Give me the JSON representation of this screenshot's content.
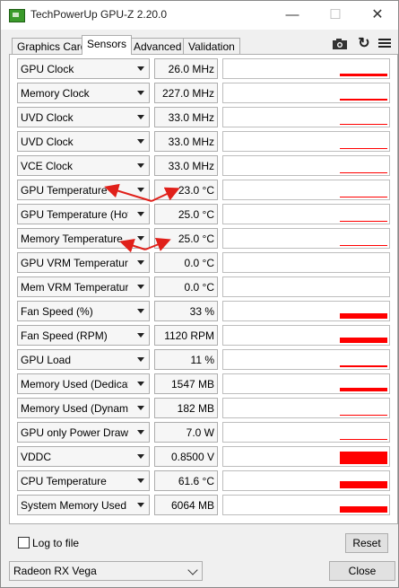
{
  "window": {
    "title": "TechPowerUp GPU-Z 2.20.0",
    "minimize_icon": "minimize-icon",
    "maximize_icon": "maximize-icon",
    "close_icon": "close-icon"
  },
  "tabs": [
    {
      "label": "Graphics Card",
      "active": false
    },
    {
      "label": "Sensors",
      "active": true
    },
    {
      "label": "Advanced",
      "active": false
    },
    {
      "label": "Validation",
      "active": false
    }
  ],
  "toolbar": {
    "icons": [
      "camera-icon",
      "refresh-icon",
      "hamburger-menu-icon"
    ]
  },
  "graph_color": "#ff0000",
  "sensors": [
    {
      "name": "GPU Clock",
      "value": "26.0 MHz",
      "graph_level": 0.15
    },
    {
      "name": "Memory Clock",
      "value": "227.0 MHz",
      "graph_level": 0.08
    },
    {
      "name": "UVD Clock",
      "value": "33.0 MHz",
      "graph_level": 0.05
    },
    {
      "name": "UVD Clock",
      "value": "33.0 MHz",
      "graph_level": 0.05
    },
    {
      "name": "VCE Clock",
      "value": "33.0 MHz",
      "graph_level": 0.05
    },
    {
      "name": "GPU Temperature",
      "value": "23.0 °C",
      "graph_level": 0.05
    },
    {
      "name": "GPU Temperature (Hot Spot)",
      "value": "25.0 °C",
      "graph_level": 0.05
    },
    {
      "name": "Memory Temperature",
      "value": "25.0 °C",
      "graph_level": 0.05
    },
    {
      "name": "GPU VRM Temperature",
      "value": "0.0 °C",
      "graph_level": 0
    },
    {
      "name": "Mem VRM Temperature",
      "value": "0.0 °C",
      "graph_level": 0
    },
    {
      "name": "Fan Speed (%)",
      "value": "33 %",
      "graph_level": 0.33
    },
    {
      "name": "Fan Speed (RPM)",
      "value": "1120 RPM",
      "graph_level": 0.33
    },
    {
      "name": "GPU Load",
      "value": "11 %",
      "graph_level": 0.11
    },
    {
      "name": "Memory Used (Dedicated)",
      "value": "1547 MB",
      "graph_level": 0.2
    },
    {
      "name": "Memory Used (Dynamic)",
      "value": "182 MB",
      "graph_level": 0.05
    },
    {
      "name": "GPU only Power Draw",
      "value": "7.0 W",
      "graph_level": 0.05
    },
    {
      "name": "VDDC",
      "value": "0.8500 V",
      "graph_level": 0.75
    },
    {
      "name": "CPU Temperature",
      "value": "61.6 °C",
      "graph_level": 0.4
    },
    {
      "name": "System Memory Used",
      "value": "6064 MB",
      "graph_level": 0.35
    }
  ],
  "log_to_file": {
    "label": "Log to file",
    "checked": false
  },
  "reset_label": "Reset",
  "gpu_select": {
    "value": "Radeon RX Vega"
  },
  "close_label": "Close",
  "annotation_color": "#e0201a"
}
